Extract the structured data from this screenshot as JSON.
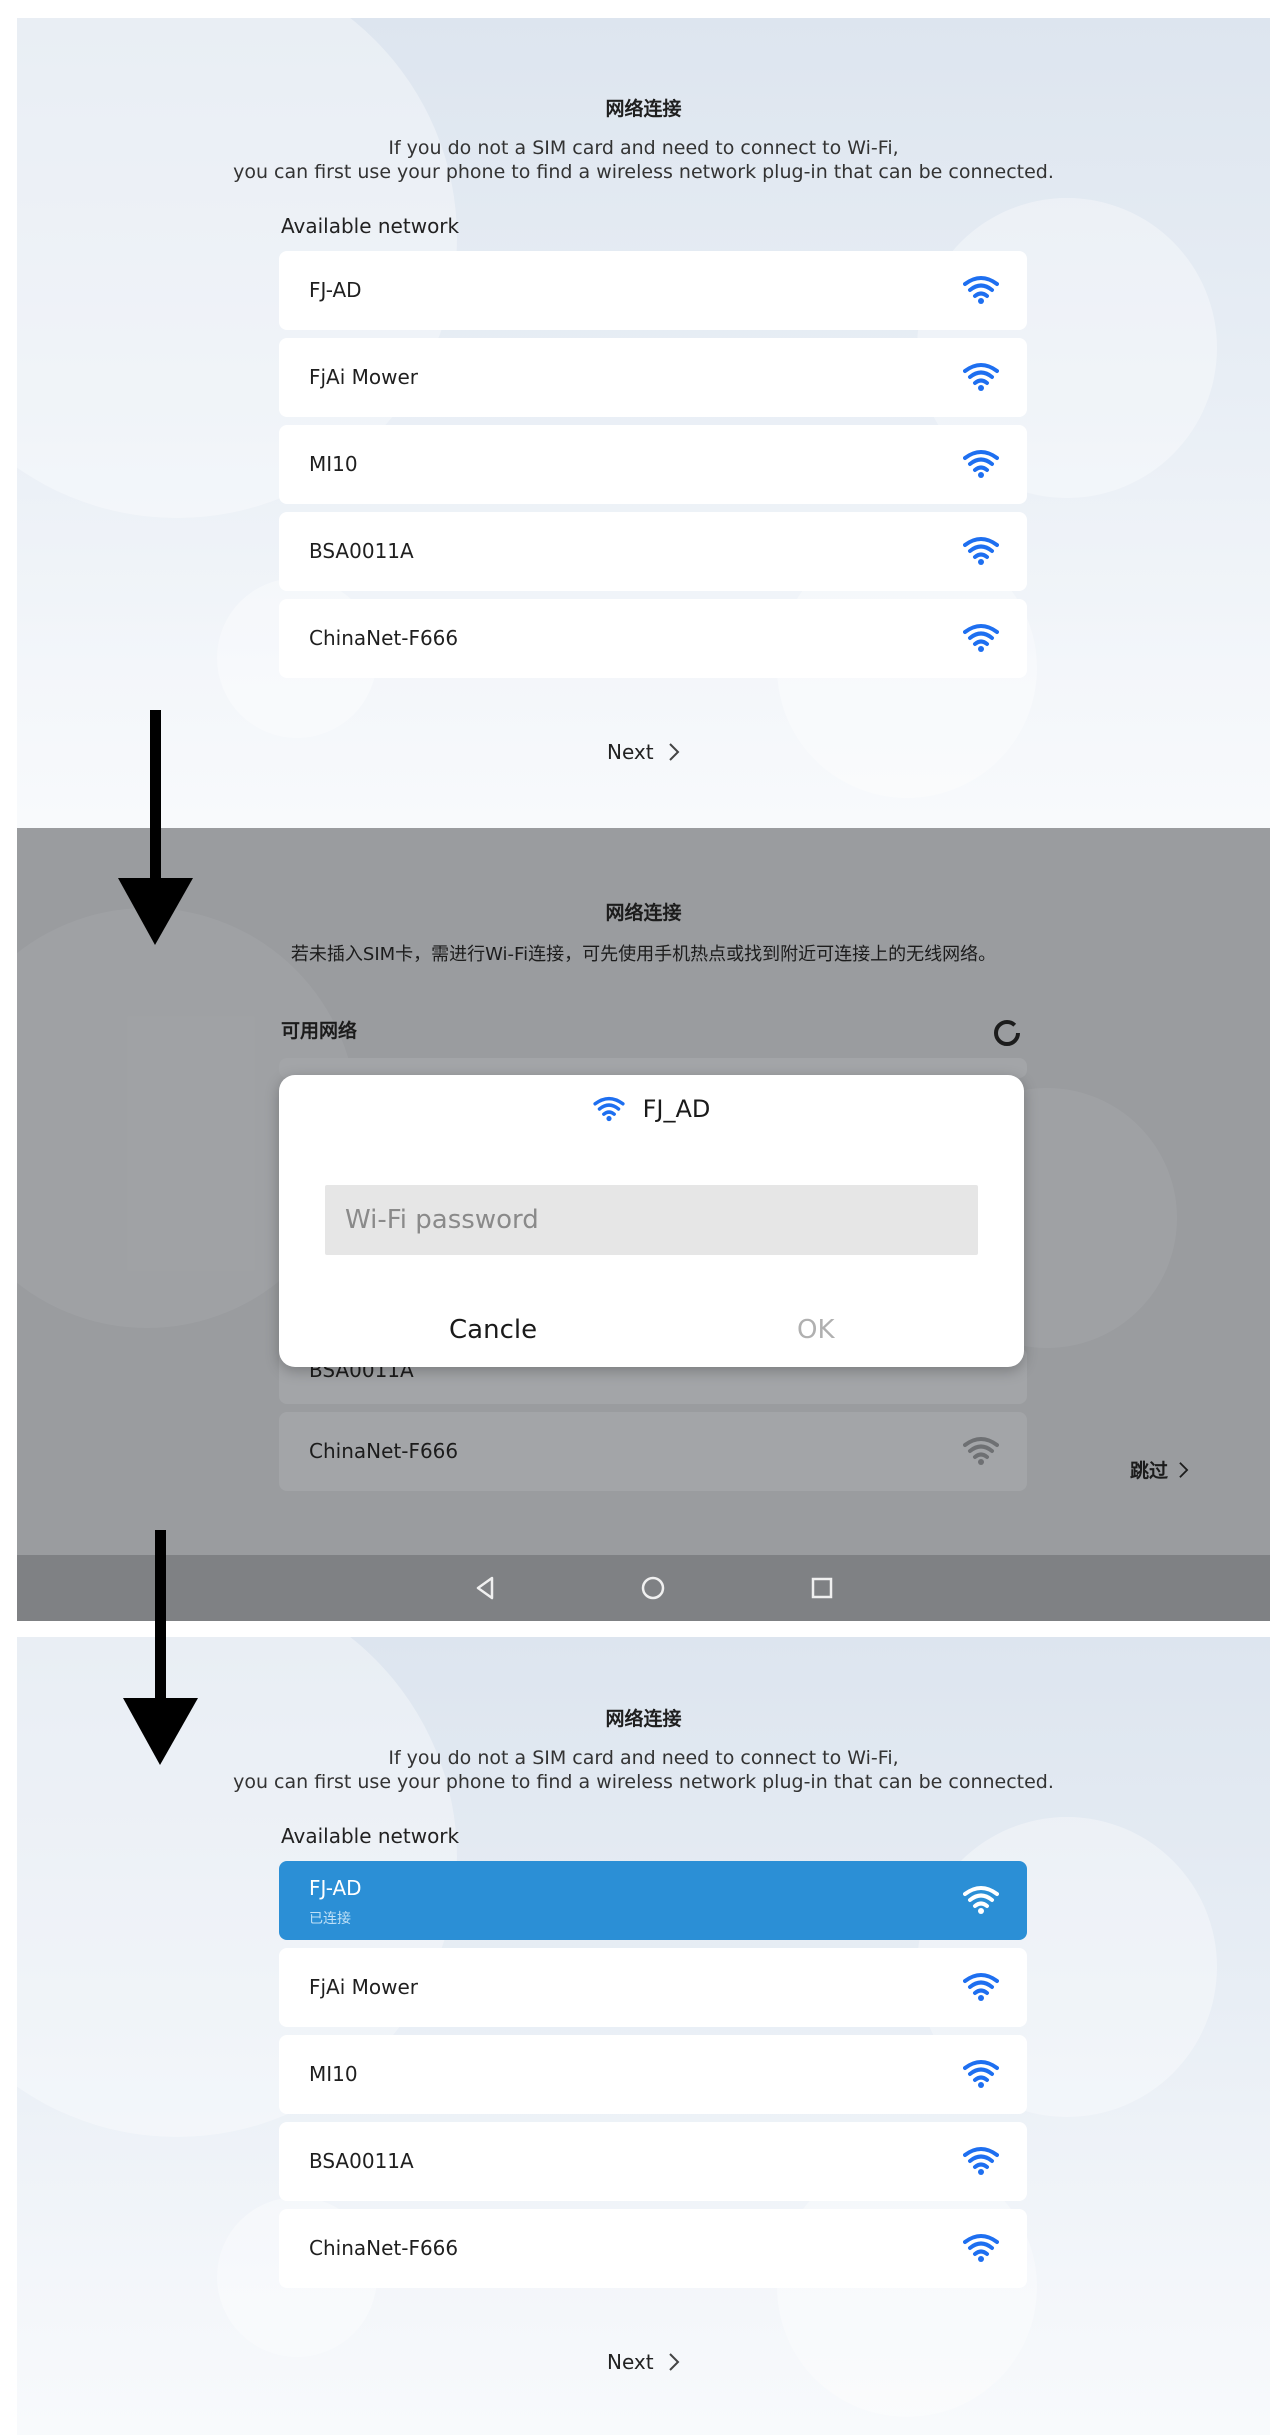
{
  "colors": {
    "accent_blue": "#2b8fd6",
    "wifi_blue": "#1e6ff0",
    "arrow": "#000000"
  },
  "step1": {
    "title": "网络连接",
    "subtitle_line1": "If you do not a SIM card and need to connect to Wi-Fi,",
    "subtitle_line2": "you can first use your phone to find a wireless network plug-in that can be connected.",
    "section_label": "Available network",
    "networks": [
      {
        "name": "FJ-AD",
        "icon": "wifi-icon"
      },
      {
        "name": "FjAi Mower",
        "icon": "wifi-icon"
      },
      {
        "name": "MI10",
        "icon": "wifi-icon"
      },
      {
        "name": "BSA0011A",
        "icon": "wifi-icon"
      },
      {
        "name": "ChinaNet-F666",
        "icon": "wifi-icon"
      }
    ],
    "next_label": "Next"
  },
  "step2": {
    "title": "网络连接",
    "subtitle": "若未插入SIM卡，需进行Wi-Fi连接，可先使用手机热点或找到附近可连接上的无线网络。",
    "section_label": "可用网络",
    "partial_network": "BSA0011A",
    "last_network": "ChinaNet-F666",
    "skip_label": "跳过",
    "dialog": {
      "network_name": "FJ_AD",
      "password_placeholder": "Wi-Fi password",
      "cancel_label": "Cancle",
      "ok_label": "OK"
    },
    "navbar": [
      "back-icon",
      "home-icon",
      "recents-icon"
    ]
  },
  "step3": {
    "title": "网络连接",
    "subtitle_line1": "If you do not a SIM card and need to connect to Wi-Fi,",
    "subtitle_line2": "you can first use your phone to find a wireless network plug-in that can be connected.",
    "section_label": "Available network",
    "networks": [
      {
        "name": "FJ-AD",
        "status": "已连接",
        "icon": "wifi-icon"
      },
      {
        "name": "FjAi Mower",
        "icon": "wifi-icon"
      },
      {
        "name": "MI10",
        "icon": "wifi-icon"
      },
      {
        "name": "BSA0011A",
        "icon": "wifi-icon"
      },
      {
        "name": "ChinaNet-F666",
        "icon": "wifi-icon"
      }
    ],
    "next_label": "Next"
  }
}
